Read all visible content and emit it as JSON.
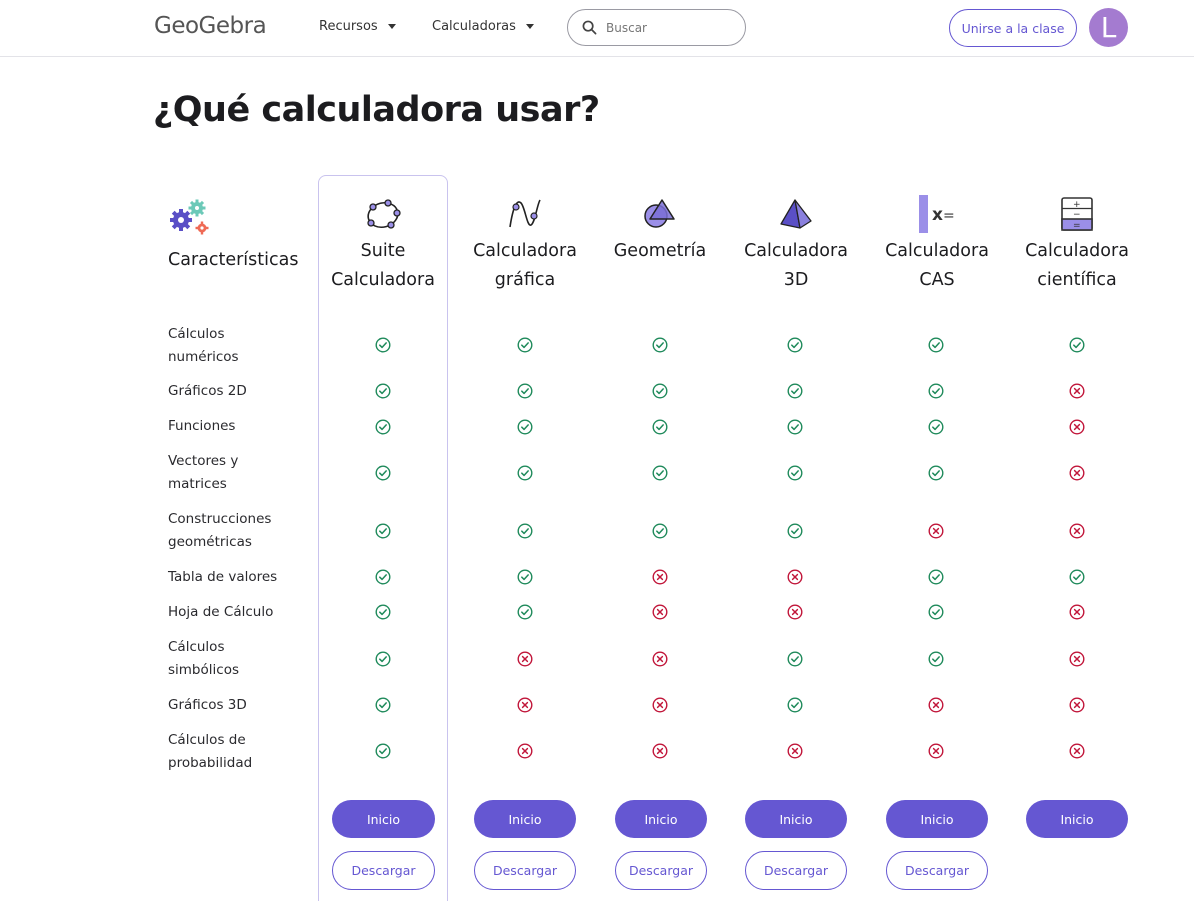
{
  "header": {
    "logo": "GeoGebra",
    "nav": [
      {
        "label": "Recursos"
      },
      {
        "label": "Calculadoras"
      }
    ],
    "search_placeholder": "Buscar",
    "join_label": "Unirse a la clase",
    "avatar_initial": "L"
  },
  "page_title": "¿Qué calculadora usar?",
  "features_heading": "Características",
  "apps": [
    {
      "name_line1": "Suite",
      "name_line2": "Calculadora",
      "icon": "suite-pentagon-icon",
      "start_label": "Inicio",
      "download_label": "Descargar"
    },
    {
      "name_line1": "Calculadora",
      "name_line2": "gráfica",
      "icon": "graphing-curve-icon",
      "start_label": "Inicio",
      "download_label": "Descargar"
    },
    {
      "name_line1": "Geometría",
      "name_line2": "",
      "icon": "geometry-shapes-icon",
      "start_label": "Inicio",
      "download_label": "Descargar"
    },
    {
      "name_line1": "Calculadora",
      "name_line2": "3D",
      "icon": "pyramid-3d-icon",
      "start_label": "Inicio",
      "download_label": "Descargar"
    },
    {
      "name_line1": "Calculadora",
      "name_line2": "CAS",
      "icon": "cas-x-equals-icon",
      "start_label": "Inicio",
      "download_label": "Descargar"
    },
    {
      "name_line1": "Calculadora",
      "name_line2": "científica",
      "icon": "scientific-calculator-icon",
      "start_label": "Inicio",
      "download_label": null
    }
  ],
  "features": [
    {
      "line1": "Cálculos",
      "line2": "numéricos",
      "support": [
        true,
        true,
        true,
        true,
        true,
        true
      ]
    },
    {
      "line1": "Gráficos 2D",
      "line2": "",
      "support": [
        true,
        true,
        true,
        true,
        true,
        false
      ]
    },
    {
      "line1": "Funciones",
      "line2": "",
      "support": [
        true,
        true,
        true,
        true,
        true,
        false
      ]
    },
    {
      "line1": "Vectores y",
      "line2": "matrices",
      "support": [
        true,
        true,
        true,
        true,
        true,
        false
      ]
    },
    {
      "line1": "Construcciones",
      "line2": "geométricas",
      "support": [
        true,
        true,
        true,
        true,
        false,
        false
      ]
    },
    {
      "line1": "Tabla de valores",
      "line2": "",
      "support": [
        true,
        true,
        false,
        false,
        true,
        true
      ]
    },
    {
      "line1": "Hoja de Cálculo",
      "line2": "",
      "support": [
        true,
        true,
        false,
        false,
        true,
        false
      ]
    },
    {
      "line1": "Cálculos",
      "line2": "simbólicos",
      "support": [
        true,
        false,
        false,
        true,
        true,
        false
      ]
    },
    {
      "line1": "Gráficos 3D",
      "line2": "",
      "support": [
        true,
        false,
        false,
        true,
        false,
        false
      ]
    },
    {
      "line1": "Cálculos de",
      "line2": "probabilidad",
      "support": [
        true,
        false,
        false,
        false,
        false,
        false
      ]
    }
  ],
  "colors": {
    "accent": "#6557d2",
    "check": "#1f8a5b",
    "cross": "#c1163a"
  }
}
